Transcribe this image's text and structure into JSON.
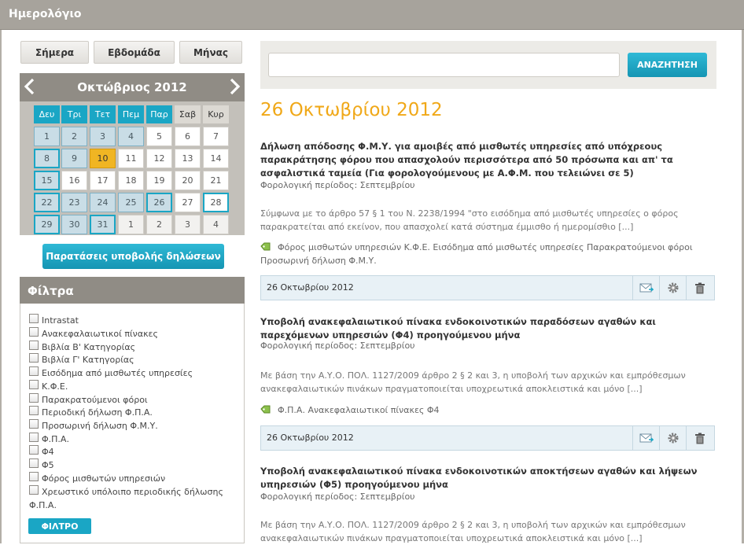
{
  "title": "Ημερολόγιο",
  "view_buttons": [
    "Σήμερα",
    "Εβδομάδα",
    "Μήνας"
  ],
  "calendar": {
    "month_label": "Οκτώβριος 2012",
    "weekdays": [
      "Δευ",
      "Τρι",
      "Τετ",
      "Πεμ",
      "Παρ",
      "Σαβ",
      "Κυρ"
    ],
    "weeks": [
      [
        "1",
        "2",
        "3",
        "4",
        "5",
        "6",
        "7"
      ],
      [
        "8",
        "9",
        "10",
        "11",
        "12",
        "13",
        "14"
      ],
      [
        "15",
        "16",
        "17",
        "18",
        "19",
        "20",
        "21"
      ],
      [
        "22",
        "23",
        "24",
        "25",
        "26",
        "27",
        "28"
      ],
      [
        "29",
        "30",
        "31",
        "1",
        "2",
        "3",
        "4"
      ]
    ],
    "today": "10"
  },
  "extensions_button": "Παρατάσεις υποβολής δηλώσεων",
  "filters": {
    "title": "Φίλτρα",
    "items": [
      "Intrastat",
      "Ανακεφαλαιωτικοί πίνακες",
      "Βιβλία Β' Κατηγορίας",
      "Βιβλία Γ' Κατηγορίας",
      "Εισόδημα από μισθωτές υπηρεσίες",
      "Κ.Φ.Ε.",
      "Παρακρατούμενοι φόροι",
      "Περιοδική δήλωση Φ.Π.Α.",
      "Προσωρινή δήλωση Φ.Μ.Υ.",
      "Φ.Π.Α.",
      "Φ4",
      "Φ5",
      "Φόρος μισθωτών υπηρεσιών",
      "Χρεωστικό υπόλοιπο περιοδικής δήλωσης Φ.Π.Α."
    ],
    "button": "ΦΙΛΤΡΟ"
  },
  "search": {
    "value": "",
    "button": "ΑΝΑΖΗΤΗΣΗ"
  },
  "date_heading": "26 Οκτωβρίου 2012",
  "entries": [
    {
      "title": "Δήλωση απόδοσης Φ.Μ.Υ. για αμοιβές από μισθωτές υπηρεσίες από υπόχρεους παρακράτησης φόρου που απασχολούν περισσότερα από 50 πρόσωπα και απ' τα ασφαλιστικά ταμεία (Για φορολογούμενους με Α.Φ.Μ. που τελειώνει σε 5)",
      "period": "Φορολογική περίοδος: Σεπτεμβρίου",
      "body": "Σύμφωνα με το άρθρο 57 § 1 του Ν. 2238/1994 \"στο εισόδημα από μισθωτές υπηρεσίες ο φόρος παρακρατείται από εκείνον, που απασχολεί κατά σύστημα έμμισθο ή ημερομίσθιο [...]",
      "tags": "Φόρος μισθωτών υπηρεσιών Κ.Φ.Ε. Εισόδημα από μισθωτές υπηρεσίες Παρακρατούμενοι φόροι Προσωρινή δήλωση Φ.Μ.Υ.",
      "date": "26 Οκτωβρίου 2012"
    },
    {
      "title": "Υποβολή ανακεφαλαιωτικού πίνακα ενδοκοινοτικών παραδόσεων αγαθών και παρεχόμενων υπηρεσιών (Φ4) προηγούμενου μήνα",
      "period": "Φορολογική περίοδος: Σεπτεμβρίου",
      "body": "Με βάση την Α.Υ.Ο. ΠΟΛ. 1127/2009 άρθρο 2 § 2 και 3, η υποβολή των αρχικών και εμπρόθεσμων ανακεφαλαιωτικών πινάκων πραγματοποιείται υποχρεωτικά αποκλειστικά και μόνο [...]",
      "tags": "Φ.Π.Α. Ανακεφαλαιωτικοί πίνακες Φ4",
      "date": "26 Οκτωβρίου 2012"
    },
    {
      "title": "Υποβολή ανακεφαλαιωτικού πίνακα ενδοκοινοτικών αποκτήσεων αγαθών και λήψεων υπηρεσιών (Φ5) προηγούμενου μήνα",
      "period": "Φορολογική περίοδος: Σεπτεμβρίου",
      "body": "Με βάση την Α.Υ.Ο. ΠΟΛ. 1127/2009 άρθρο 2 § 2 και 3, η υποβολή των αρχικών και εμπρόθεσμων ανακεφαλαιωτικών πινάκων πραγματοποιείται υποχρεωτικά αποκλειστικά και μόνο [...]"
    }
  ],
  "icons": {
    "prev": "chevron-left-icon",
    "next": "chevron-right-icon",
    "tag": "tag-icon",
    "email": "email-icon",
    "settings": "gear-icon",
    "delete": "trash-icon"
  },
  "colors": {
    "accent": "#1aa6c5",
    "heading": "#f0a818",
    "today": "#f0b523",
    "panel_header": "#908c85"
  }
}
